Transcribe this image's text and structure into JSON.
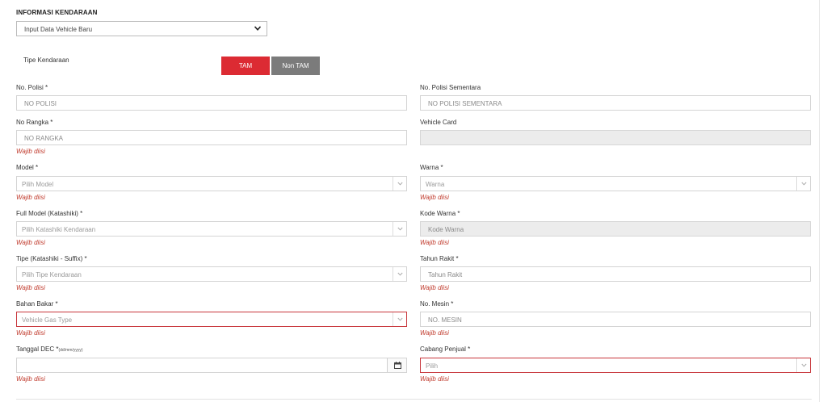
{
  "section_title": "INFORMASI KENDARAAN",
  "top_select": {
    "value": "Input Data Vehicle Baru"
  },
  "tipe_kendaraan": {
    "label": "Tipe Kendaraan",
    "tam": "TAM",
    "non_tam": "Non TAM",
    "active": "TAM",
    "active_color": "#dc2b33",
    "inactive_color": "#7b7b7b"
  },
  "required_hint": "Wajib diisi",
  "fields": {
    "no_polisi": {
      "label": "No. Polisi *",
      "placeholder": "NO POLISI"
    },
    "no_polisi_sementara": {
      "label": "No. Polisi Sementara",
      "placeholder": "NO POLISI SEMENTARA"
    },
    "no_rangka": {
      "label": "No Rangka *",
      "placeholder": "NO RANGKA"
    },
    "vehicle_card": {
      "label": "Vehicle Card",
      "value": ""
    },
    "model": {
      "label": "Model *",
      "placeholder": "Pilih Model"
    },
    "warna": {
      "label": "Warna *",
      "placeholder": "Warna"
    },
    "full_model": {
      "label": "Full Model (Katashiki) *",
      "placeholder": "Pilih Katashiki Kendaraan"
    },
    "kode_warna": {
      "label": "Kode Warna *",
      "placeholder": "Kode Warna"
    },
    "tipe": {
      "label": "Tipe (Katashiki - Suffix) *",
      "placeholder": "Pilih Tipe Kendaraan"
    },
    "tahun_rakit": {
      "label": "Tahun Rakit *",
      "placeholder": "Tahun Rakit"
    },
    "bahan_bakar": {
      "label": "Bahan Bakar *",
      "placeholder": "Vehicle Gas Type"
    },
    "no_mesin": {
      "label": "No. Mesin *",
      "placeholder": "NO. MESIN"
    },
    "tanggal_dec": {
      "label": "Tanggal DEC *",
      "format": "(dd/mm/yyyy)",
      "value": ""
    },
    "cabang_penjual": {
      "label": "Cabang Penjual *",
      "placeholder": "Pilih"
    }
  },
  "colors": {
    "error": "#c0392b",
    "error_border": "#c8373c",
    "disabled_bg": "#ececec"
  }
}
